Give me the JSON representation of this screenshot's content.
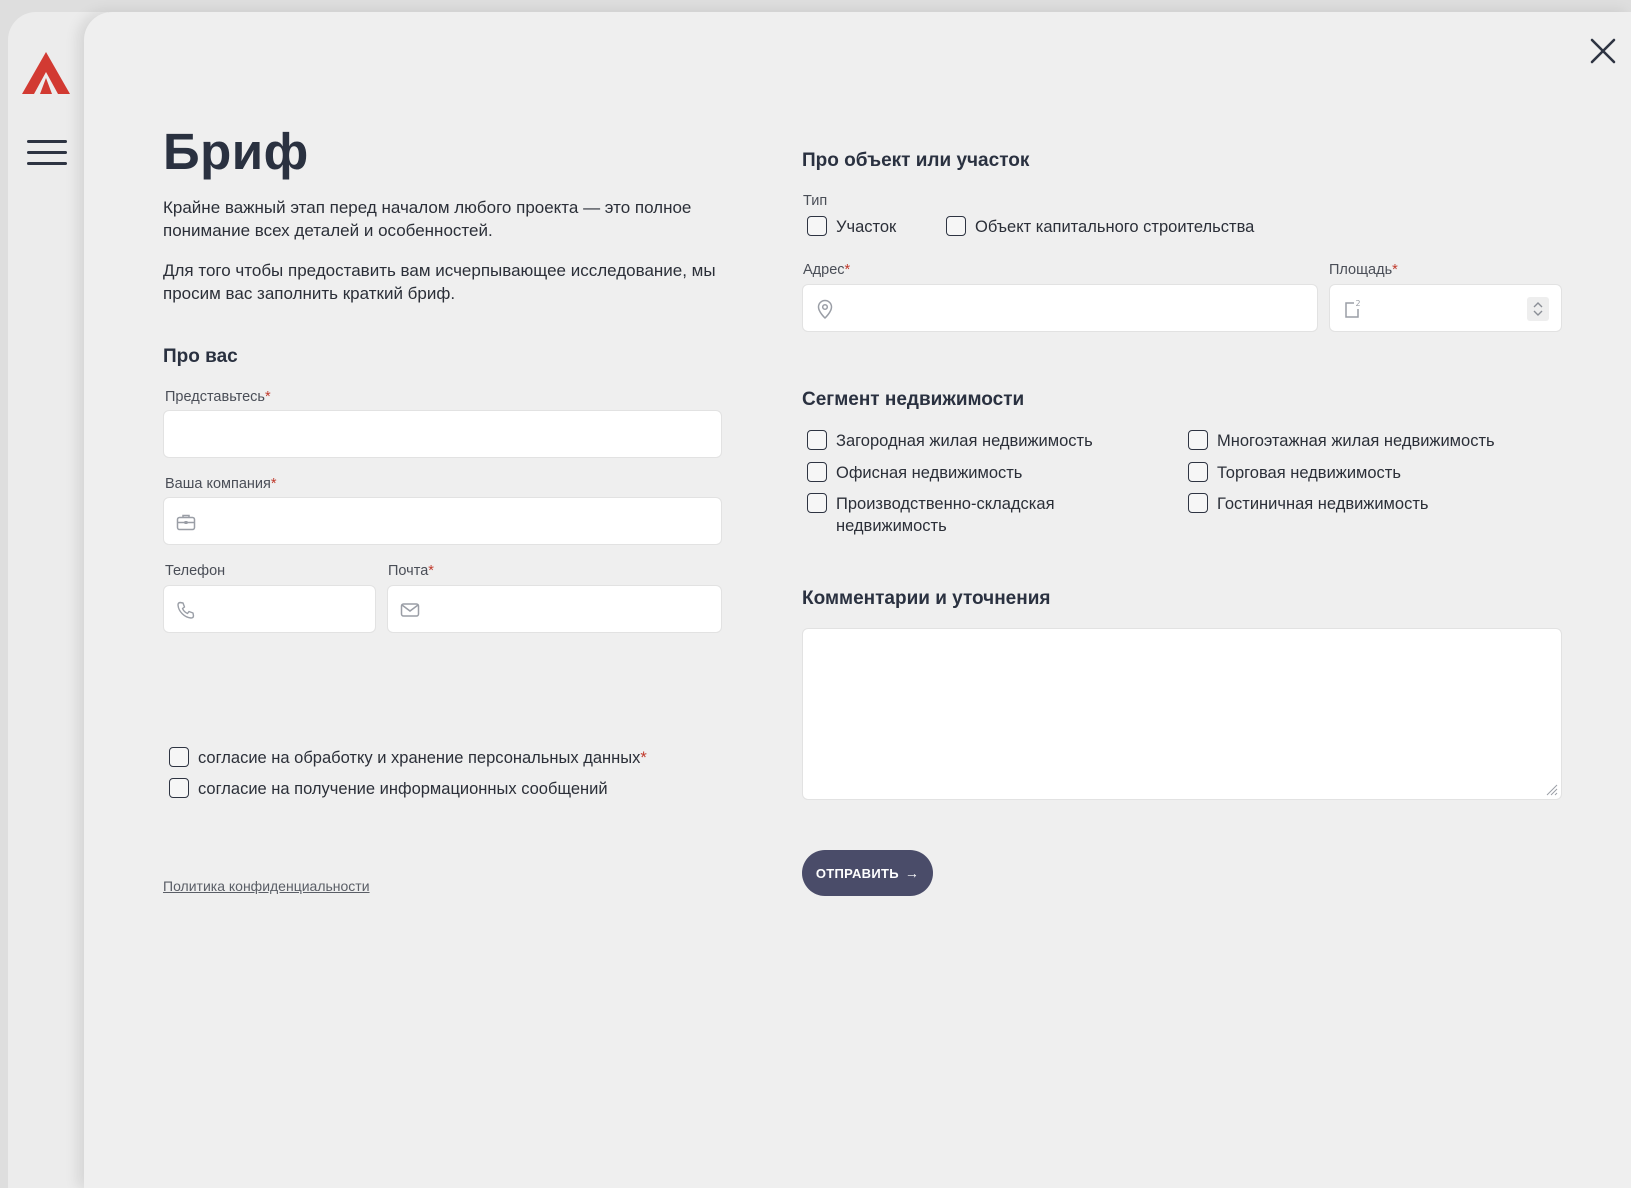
{
  "brand": {
    "logo": "logo-icon",
    "accent": "#d23a32"
  },
  "header": {
    "title": "Бриф"
  },
  "intro": {
    "p1": "Крайне важный этап перед началом любого проекта — это полное понимание всех деталей и особенностей.",
    "p2": "Для того чтобы предоставить вам исчерпывающее исследование, мы просим вас заполнить краткий бриф."
  },
  "about": {
    "title": "Про вас",
    "name_label": "Представьтесь",
    "company_label": "Ваша компания",
    "phone_label": "Телефон",
    "email_label": "Почта",
    "name_value": "",
    "company_value": "",
    "phone_value": "",
    "email_value": ""
  },
  "object": {
    "title": "Про объект или участок",
    "type_label": "Тип",
    "types": [
      "Участок",
      "Объект капитального строительства"
    ],
    "address_label": "Адрес",
    "area_label": "Площадь",
    "address_value": "",
    "area_value": ""
  },
  "segment": {
    "title": "Сегмент недвижимости",
    "left": [
      "Загородная жилая недвижимость",
      "Офисная недвижимость",
      "Производственно-складская недвижимость"
    ],
    "right": [
      "Многоэтажная жилая недвижимость",
      "Торговая недвижимость",
      "Гостиничная недвижимость"
    ]
  },
  "comments": {
    "title": "Комментарии и уточнения",
    "value": ""
  },
  "consents": [
    "согласие на обработку и хранение персональных данных",
    "согласие на получение информационных сообщений"
  ],
  "required_mark": "*",
  "submit": {
    "label": "ОТПРАВИТЬ",
    "arrow": "→"
  },
  "policy_link": "Политика конфиденциальности"
}
